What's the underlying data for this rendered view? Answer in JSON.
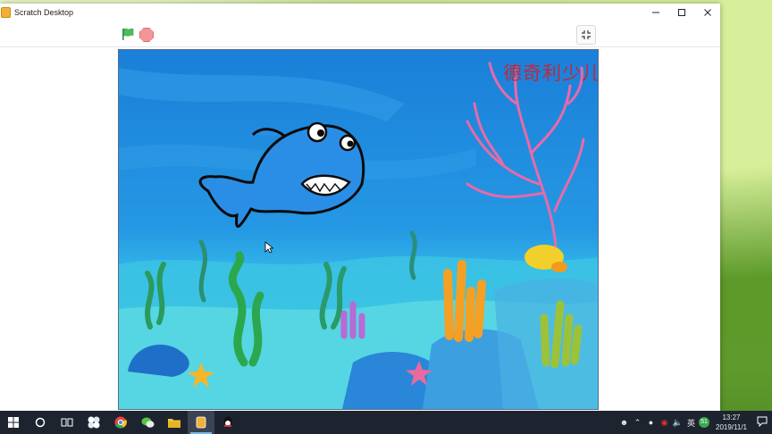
{
  "window": {
    "title": "Scratch Desktop",
    "controls": {
      "minimize_icon": "minimize-icon",
      "maximize_icon": "maximize-icon",
      "close_icon": "close-icon"
    }
  },
  "toolbar": {
    "green_flag_icon": "green-flag-icon",
    "stop_icon": "stop-icon",
    "fullscreen_icon": "exit-fullscreen-icon"
  },
  "stage": {
    "caption": "德奇利少儿编程",
    "sprite": "shark",
    "backdrop": "underwater"
  },
  "taskbar": {
    "items": [
      {
        "name": "start-icon"
      },
      {
        "name": "cortana-icon"
      },
      {
        "name": "task-view-icon"
      },
      {
        "name": "pinwheel-icon"
      },
      {
        "name": "chrome-icon"
      },
      {
        "name": "wechat-icon"
      },
      {
        "name": "file-explorer-icon"
      },
      {
        "name": "scratch-icon"
      },
      {
        "name": "qq-icon"
      }
    ],
    "tray": {
      "ime_label": "英",
      "badge": "51",
      "time": "13:27",
      "date": "2019/11/1"
    }
  },
  "colors": {
    "stage_water": "#1f8ee0",
    "caption_red": "#c0283c",
    "flag_green": "#4cbf56",
    "stop_red": "#f3949a",
    "taskbar": "#1d2430"
  }
}
